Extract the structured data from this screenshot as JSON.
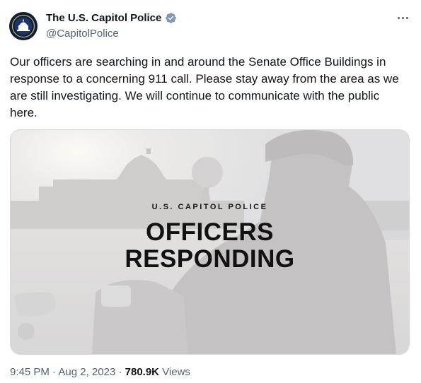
{
  "author": {
    "name": "The U.S. Capitol Police",
    "handle": "@CapitolPolice",
    "verified": true,
    "avatar_icon": "capitol-police-badge-icon"
  },
  "tweet": {
    "text": "Our officers are searching in and around the Senate Office Buildings in response to a concerning 911 call. Please stay away from the area as we are still investigating. We will continue to communicate with the public here."
  },
  "media": {
    "kicker": "U.S. CAPITOL POLICE",
    "headline_line1": "OFFICERS",
    "headline_line2": "RESPONDING"
  },
  "meta": {
    "time": "9:45 PM",
    "separator": "·",
    "date": "Aug 2, 2023",
    "views_count": "780.9K",
    "views_label": "Views"
  },
  "colors": {
    "text": "#0f1419",
    "secondary": "#536471",
    "verified": "#829aab",
    "border": "#cfd9de"
  },
  "icons": {
    "more": "more-horizontal-icon",
    "verified": "verified-badge-icon"
  }
}
